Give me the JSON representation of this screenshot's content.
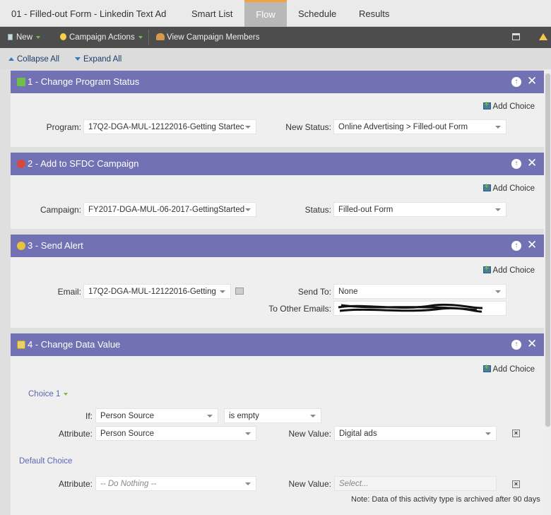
{
  "tabs": [
    {
      "label": "01 - Filled-out Form - Linkedin Text Ad"
    },
    {
      "label": "Smart List"
    },
    {
      "label": "Flow"
    },
    {
      "label": "Schedule"
    },
    {
      "label": "Results"
    }
  ],
  "toolbar": {
    "new_label": "New",
    "campaign_actions_label": "Campaign Actions",
    "view_members_label": "View Campaign Members"
  },
  "subbar": {
    "collapse_all": "Collapse All",
    "expand_all": "Expand All"
  },
  "flows": {
    "add_choice": "Add Choice",
    "step1": {
      "title": "1 - Change Program Status",
      "program_label": "Program:",
      "program_value": "17Q2-DGA-MUL-12122016-Getting Startec",
      "status_label": "New Status:",
      "status_value": "Online Advertising > Filled-out Form"
    },
    "step2": {
      "title": "2 - Add to SFDC Campaign",
      "campaign_label": "Campaign:",
      "campaign_value": "FY2017-DGA-MUL-06-2017-GettingStarted",
      "status_label": "Status:",
      "status_value": "Filled-out Form"
    },
    "step3": {
      "title": "3 - Send Alert",
      "email_label": "Email:",
      "email_value": "17Q2-DGA-MUL-12122016-Getting",
      "sendto_label": "Send To:",
      "sendto_value": "None",
      "other_emails_label": "To Other Emails:"
    },
    "step4": {
      "title": "4 - Change Data Value",
      "choice1": "Choice 1",
      "if_label": "If:",
      "if_field": "Person Source",
      "if_operator": "is empty",
      "attribute_label": "Attribute:",
      "attribute_value": "Person Source",
      "newvalue_label": "New Value:",
      "newvalue_value": "Digital ads",
      "default_choice": "Default Choice",
      "default_attribute_value": "-- Do Nothing --",
      "default_newvalue_placeholder": "Select...",
      "note": "Note: Data of this activity type is archived after 90 days"
    }
  },
  "colors": {
    "panel_header": "#7171b3",
    "tab_accent": "#f2a33a",
    "toolbar_bg": "#4d4d4d"
  }
}
